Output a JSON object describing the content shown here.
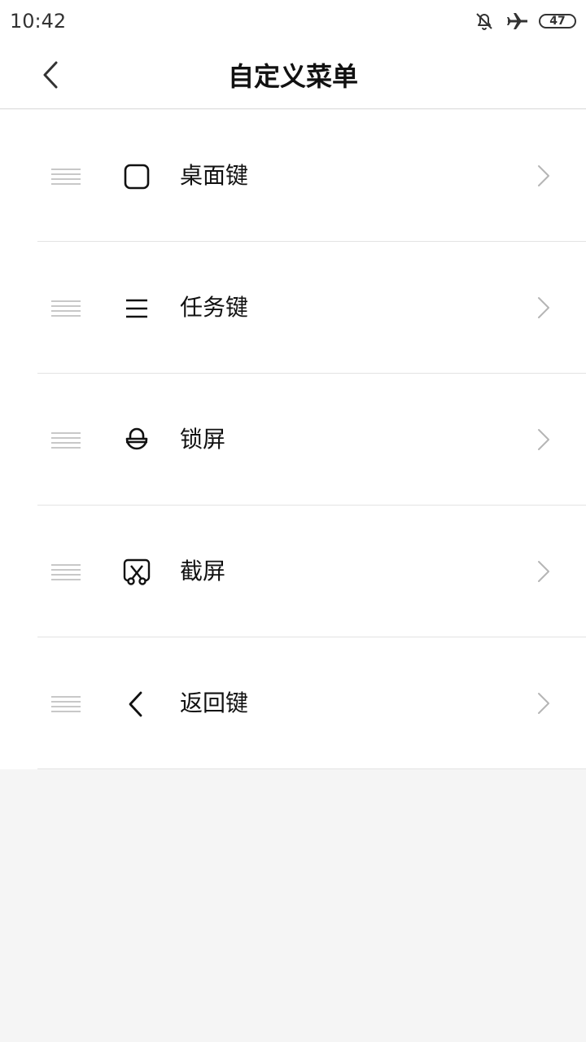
{
  "status_bar": {
    "time": "10:42",
    "icons": [
      "bell-muted-icon",
      "airplane-icon",
      "battery-icon"
    ],
    "battery_level": "47"
  },
  "header": {
    "back_icon": "back-arrow-icon",
    "title": "自定义菜单"
  },
  "menu": {
    "items": [
      {
        "label": "桌面键",
        "icon": "square-icon"
      },
      {
        "label": "任务键",
        "icon": "menu-lines-icon"
      },
      {
        "label": "锁屏",
        "icon": "lock-icon"
      },
      {
        "label": "截屏",
        "icon": "scissors-icon"
      },
      {
        "label": "返回键",
        "icon": "back-chevron-icon"
      }
    ]
  },
  "colors": {
    "background": "#f5f5f5",
    "surface": "#ffffff",
    "divider": "#e3e3e3",
    "handle": "#c8c8c8",
    "chevron": "#b5b5b5",
    "text": "#111111"
  }
}
